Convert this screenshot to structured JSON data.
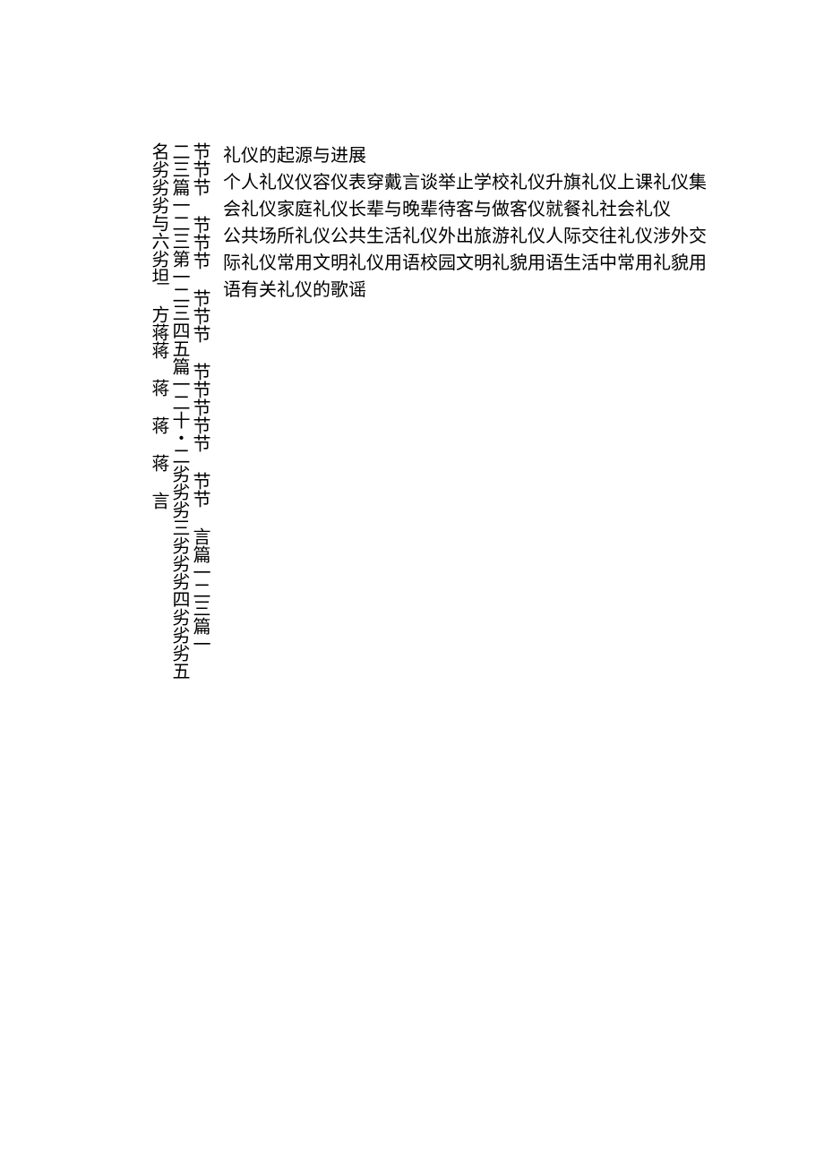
{
  "vertical_columns": {
    "col1": "名劣劣劣与六劣坦   方蒋蒋   蒋   蒋   蒋   言",
    "col2": "二三篇一二三第一二三四五篇一二十・二劣劣劣三劣劣劣四劣劣劣五",
    "col3": "              节节节  节节节  节节节  节节节节节  节节  言篇一二三篇一"
  },
  "horizontal_paragraphs": [
    "礼仪的起源与进展",
    "个人礼仪仪容仪表穿戴言谈举止学校礼仪升旗礼仪上课礼仪集会礼仪家庭礼仪长辈与晚辈待客与做客仪就餐礼社会礼仪",
    "公共场所礼仪公共生活礼仪外出旅游礼仪人际交往礼仪涉外交际礼仪常用文明礼仪用语校园文明礼貌用语生活中常用礼貌用语有关礼仪的歌谣"
  ]
}
